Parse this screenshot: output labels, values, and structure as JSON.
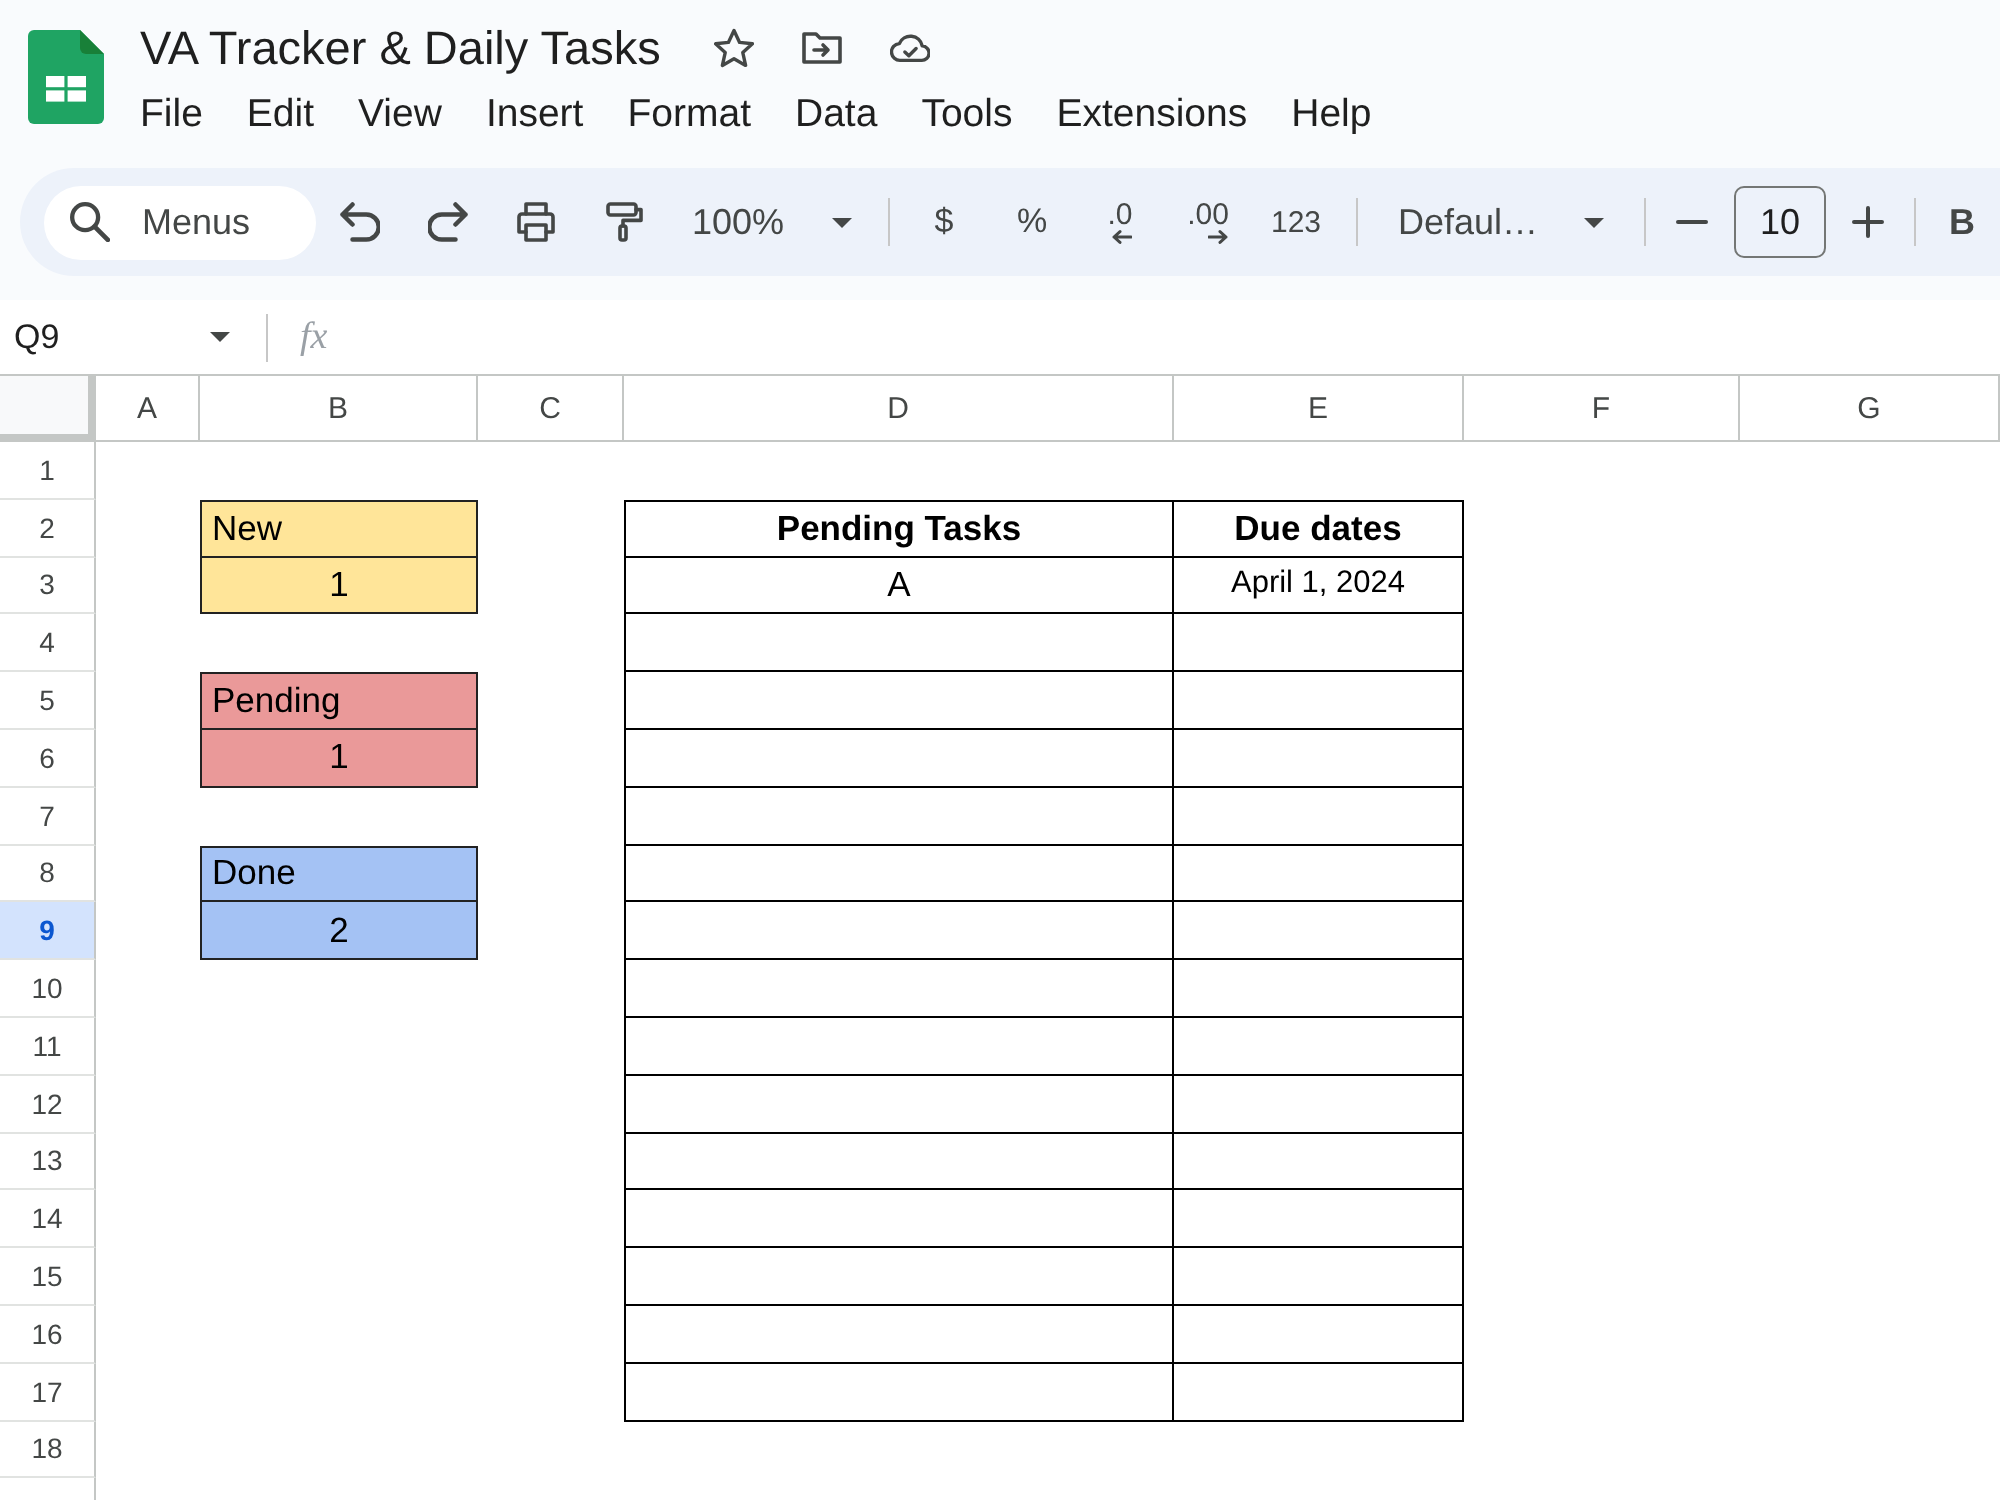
{
  "document": {
    "title": "VA Tracker & Daily Tasks"
  },
  "menu_bar": [
    "File",
    "Edit",
    "View",
    "Insert",
    "Format",
    "Data",
    "Tools",
    "Extensions",
    "Help"
  ],
  "toolbar": {
    "search_label": "Menus",
    "zoom": "100%",
    "currency_format": "$",
    "percent_format": "%",
    "decrease_decimal": ".0",
    "increase_decimal": ".00",
    "more_formats": "123",
    "font": "Defaul…",
    "font_size": "10",
    "bold": "B"
  },
  "formula_bar": {
    "name_box": "Q9",
    "function_label": "fx"
  },
  "sheet": {
    "columns": [
      "A",
      "B",
      "C",
      "D",
      "E",
      "F",
      "G"
    ],
    "rows": [
      {
        "label": "1",
        "selected": false
      },
      {
        "label": "2",
        "selected": false
      },
      {
        "label": "3",
        "selected": false
      },
      {
        "label": "4",
        "selected": false
      },
      {
        "label": "5",
        "selected": false
      },
      {
        "label": "6",
        "selected": false
      },
      {
        "label": "7",
        "selected": false
      },
      {
        "label": "8",
        "selected": false
      },
      {
        "label": "9",
        "selected": true
      },
      {
        "label": "10",
        "selected": false
      },
      {
        "label": "11",
        "selected": false
      },
      {
        "label": "12",
        "selected": false
      },
      {
        "label": "13",
        "selected": false
      },
      {
        "label": "14",
        "selected": false
      },
      {
        "label": "15",
        "selected": false
      },
      {
        "label": "16",
        "selected": false
      },
      {
        "label": "17",
        "selected": false
      },
      {
        "label": "18",
        "selected": false
      }
    ],
    "status_boxes": [
      {
        "label": "New",
        "count": "1",
        "color": "#ffe599"
      },
      {
        "label": "Pending",
        "count": "1",
        "color": "#ea9999"
      },
      {
        "label": "Done",
        "count": "2",
        "color": "#a4c2f4"
      }
    ],
    "task_table": {
      "headers": [
        "Pending Tasks",
        "Due dates"
      ],
      "rows": [
        {
          "task": "A",
          "due_date": "April 1, 2024"
        },
        {},
        {},
        {},
        {},
        {},
        {},
        {},
        {},
        {},
        {},
        {},
        {},
        {},
        {}
      ]
    }
  }
}
